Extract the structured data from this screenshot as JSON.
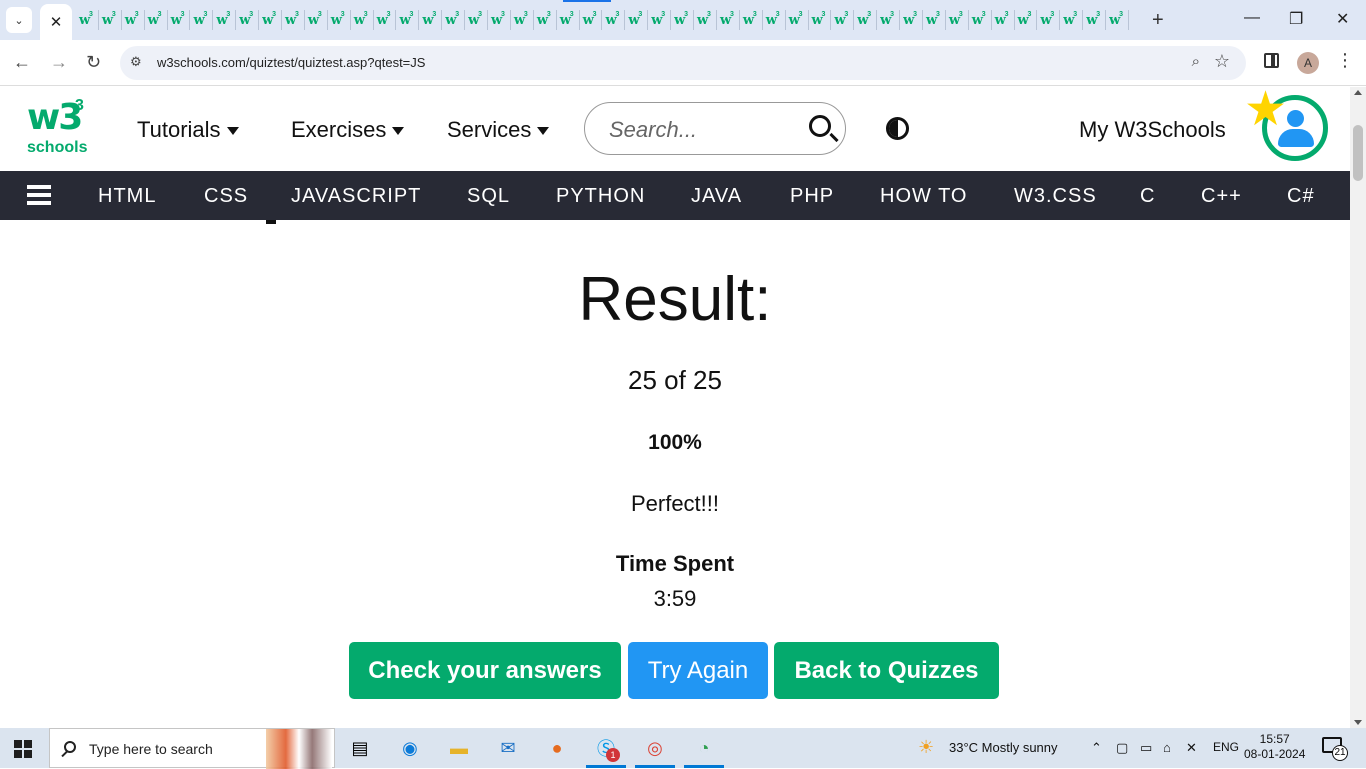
{
  "browser": {
    "tab_fav_count": 46,
    "tab_fav_letter": "w",
    "tab_fav_sup": "3",
    "active_tab_close": "✕",
    "new_tab": "+",
    "window_controls": {
      "minimize": "—",
      "restore": "❐",
      "close": "✕"
    },
    "url": "w3schools.com/quiztest/quiztest.asp?qtest=JS",
    "profile_initial": "A"
  },
  "site": {
    "logo_main": "w3",
    "logo_sup": "3",
    "logo_word": "schools",
    "menu": [
      {
        "label": "Tutorials"
      },
      {
        "label": "Exercises"
      },
      {
        "label": "Services"
      }
    ],
    "search_placeholder": "Search...",
    "my_account": "My W3Schools",
    "nav": [
      "HTML",
      "CSS",
      "JAVASCRIPT",
      "SQL",
      "PYTHON",
      "JAVA",
      "PHP",
      "HOW TO",
      "W3.CSS",
      "C",
      "C++",
      "C#"
    ]
  },
  "result": {
    "title": "Result:",
    "score": "25 of 25",
    "percent": "100%",
    "verdict": "Perfect!!!",
    "time_label": "Time Spent",
    "time_value": "3:59",
    "buttons": {
      "check": "Check your answers",
      "try_again": "Try Again",
      "back": "Back to Quizzes"
    }
  },
  "taskbar": {
    "search_placeholder": "Type here to search",
    "weather": "33°C  Mostly sunny",
    "language": "ENG",
    "time": "15:57",
    "date": "08-01-2024",
    "notifications": "21",
    "skype_badge": "1"
  },
  "colors": {
    "w3_green": "#04aa6d",
    "w3_blue": "#2196f3",
    "nav_dark": "#282a35"
  }
}
